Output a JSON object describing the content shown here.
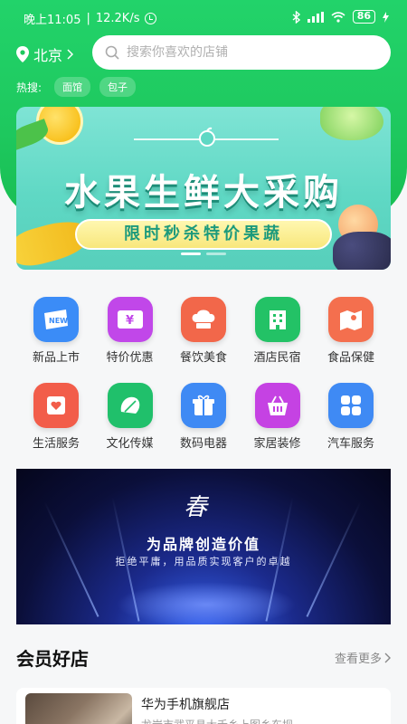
{
  "status_bar": {
    "time": "晚上11:05",
    "speed": "12.2K/s",
    "battery": "86"
  },
  "header": {
    "city": "北京",
    "search_placeholder": "搜索你喜欢的店铺"
  },
  "hot_search": {
    "label": "热搜:",
    "tags": [
      "面馆",
      "包子"
    ]
  },
  "banner": {
    "title": "水果生鲜大采购",
    "subtitle": "限时秒杀特价果蔬"
  },
  "categories": [
    {
      "label": "新品上市",
      "icon": "new-icon",
      "color": "#3b8cf7"
    },
    {
      "label": "特价优惠",
      "icon": "yen-icon",
      "color": "#c147e9"
    },
    {
      "label": "餐饮美食",
      "icon": "chef-hat-icon",
      "color": "#f2674a"
    },
    {
      "label": "酒店民宿",
      "icon": "hotel-icon",
      "color": "#23c266"
    },
    {
      "label": "食品保健",
      "icon": "map-icon",
      "color": "#f46f4e"
    },
    {
      "label": "生活服务",
      "icon": "heart-card-icon",
      "color": "#f25d4a"
    },
    {
      "label": "文化传媒",
      "icon": "cabbage-icon",
      "color": "#20c06b"
    },
    {
      "label": "数码电器",
      "icon": "gift-icon",
      "color": "#3f8af4"
    },
    {
      "label": "家居装修",
      "icon": "basket-icon",
      "color": "#c542e3"
    },
    {
      "label": "汽车服务",
      "icon": "grid-icon",
      "color": "#3f8af4"
    }
  ],
  "promo": {
    "logo": "春",
    "title": "为品牌创造价值",
    "subtitle": "拒绝平庸，用品质实现客户的卓越"
  },
  "section": {
    "title": "会员好店",
    "more": "查看更多"
  },
  "shops": [
    {
      "name": "华为手机旗舰店",
      "address": "龙岩市武平县大禾乡上图乡东坝"
    }
  ],
  "colors": {
    "brand_green": "#1ec85e"
  }
}
